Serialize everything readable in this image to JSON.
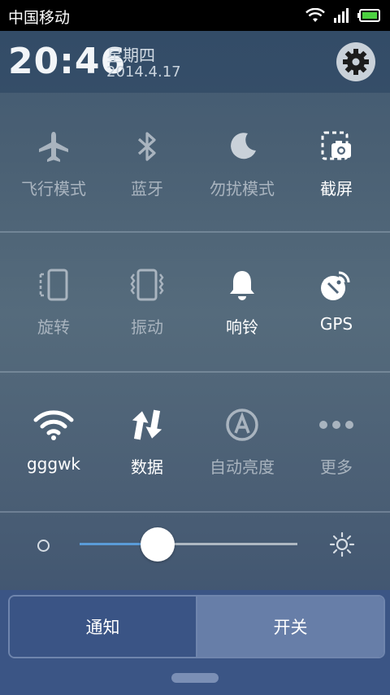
{
  "status_bar": {
    "carrier": "中国移动"
  },
  "header": {
    "time": "20:46",
    "weekday": "星期四",
    "date": "2014.4.17"
  },
  "toggles": {
    "row1": [
      {
        "label": "飞行模式",
        "icon": "airplane-icon",
        "state": "off"
      },
      {
        "label": "蓝牙",
        "icon": "bluetooth-icon",
        "state": "off"
      },
      {
        "label": "勿扰模式",
        "icon": "moon-icon",
        "state": "off"
      },
      {
        "label": "截屏",
        "icon": "screenshot-icon",
        "state": "on"
      }
    ],
    "row2": [
      {
        "label": "旋转",
        "icon": "rotate-icon",
        "state": "off"
      },
      {
        "label": "振动",
        "icon": "vibrate-icon",
        "state": "off"
      },
      {
        "label": "响铃",
        "icon": "bell-icon",
        "state": "on"
      },
      {
        "label": "GPS",
        "icon": "gps-icon",
        "state": "on"
      }
    ],
    "row3": [
      {
        "label": "gggwk",
        "icon": "wifi-icon",
        "state": "on"
      },
      {
        "label": "数据",
        "icon": "data-icon",
        "state": "on"
      },
      {
        "label": "自动亮度",
        "icon": "auto-brightness-icon",
        "state": "off"
      },
      {
        "label": "更多",
        "icon": "more-icon",
        "state": "off"
      }
    ]
  },
  "brightness": {
    "level": 0.36
  },
  "tabs": {
    "notify": "通知",
    "switches": "开关"
  },
  "colors": {
    "accent": "#5a9bd8",
    "battery": "#4cd040"
  }
}
